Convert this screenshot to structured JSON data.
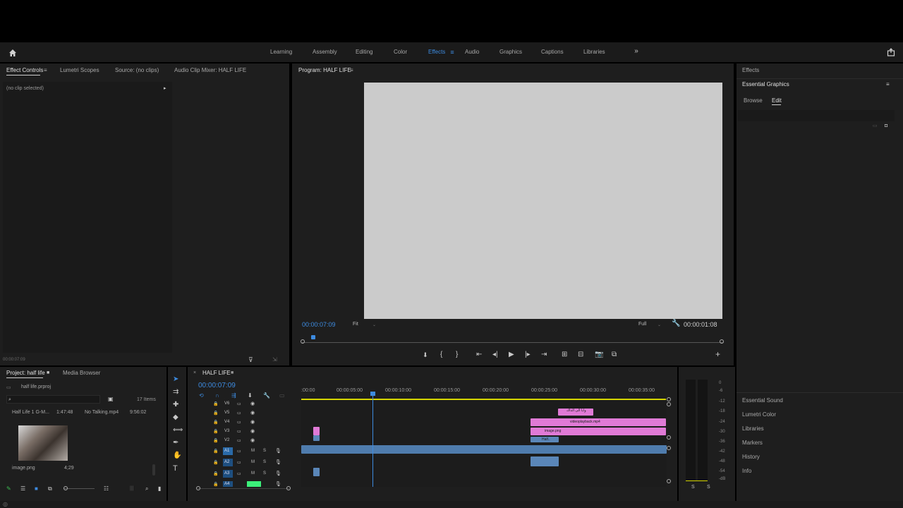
{
  "topbar": {
    "workspaces": [
      {
        "label": "Learning",
        "active": false
      },
      {
        "label": "Assembly",
        "active": false
      },
      {
        "label": "Editing",
        "active": false
      },
      {
        "label": "Color",
        "active": false
      },
      {
        "label": "Effects",
        "active": true
      },
      {
        "label": "Audio",
        "active": false
      },
      {
        "label": "Graphics",
        "active": false
      },
      {
        "label": "Captions",
        "active": false
      },
      {
        "label": "Libraries",
        "active": false
      }
    ],
    "more_icon": "double-chevron-right-icon",
    "home_icon": "home-icon",
    "share_icon": "share-icon"
  },
  "source_panel": {
    "tabs": [
      "Effect Controls",
      "Lumetri Scopes",
      "Source: (no clips)",
      "Audio Clip Mixer: HALF LIFE"
    ],
    "no_clip_text": "(no clip selected)",
    "timecode": "00:00:07:09"
  },
  "program_monitor": {
    "title": "Program: HALF LIFE",
    "current_time": "00:00:07:09",
    "fit": "Fit",
    "quality": "Full",
    "duration": "00:00:01:08"
  },
  "project_panel": {
    "tabs": [
      "Project: half life",
      "Media Browser"
    ],
    "project_file": "half life.prproj",
    "item_count": "17 Items",
    "columns": [
      "Half Life 1 G-M...",
      "1:47:48",
      "No Talking.mp4",
      "9:56:02"
    ],
    "thumbnail_label": "image.png",
    "thumbnail_duration": "4;29"
  },
  "timeline": {
    "sequence_name": "HALF LIFE",
    "current_time": "00:00:07:09",
    "ruler": [
      ":00:00",
      "00:00:05:00",
      "00:00:10:00",
      "00:00:15:00",
      "00:00:20:00",
      "00:00:25:00",
      "00:00:30:00",
      "00:00:35:00"
    ],
    "video_tracks": [
      "V6",
      "V5",
      "V4",
      "V3",
      "V2"
    ],
    "audio_tracks": [
      "A1",
      "A2",
      "A3",
      "A4"
    ],
    "clips": {
      "title_clip": "وايا الى الذاك",
      "video_clip": "videoplayback.mp4",
      "image_clip": "image.png",
      "half_clip": "Half.."
    }
  },
  "right_panel": {
    "effects_tab": "Effects",
    "essential_graphics": "Essential Graphics",
    "subtabs": [
      "Browse",
      "Edit"
    ],
    "bottom_items": [
      "Essential Sound",
      "Lumetri Color",
      "Libraries",
      "Markers",
      "History",
      "Info"
    ]
  },
  "audio_meter": {
    "labels": [
      "0",
      "-6",
      "-12",
      "-18",
      "-24",
      "-30",
      "-36",
      "-42",
      "-48",
      "-54",
      "-dB"
    ],
    "solo": [
      "S",
      "S"
    ]
  },
  "colors": {
    "accent": "#3d8be0",
    "clip_pink": "#e07ad6",
    "clip_audio": "#5a86b8",
    "clip_green": "#3cbf52"
  }
}
